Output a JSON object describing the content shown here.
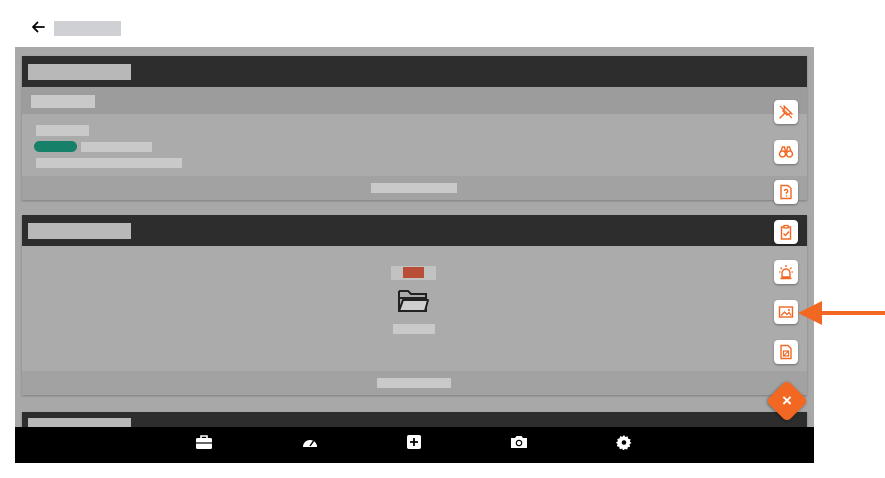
{
  "topbar": {
    "back_icon": "arrow-left-icon"
  },
  "colors": {
    "accent": "#f26822",
    "status_pill": "#168068",
    "header": "#2d2d2d",
    "overlay": "#a8a8a8"
  },
  "side_actions": [
    {
      "icon": "pin-icon"
    },
    {
      "icon": "binoculars-icon"
    },
    {
      "icon": "document-question-icon"
    },
    {
      "icon": "clipboard-check-icon"
    },
    {
      "icon": "alarm-light-icon"
    },
    {
      "icon": "image-icon"
    },
    {
      "icon": "document-drawing-icon"
    }
  ],
  "close_fab": {
    "label": "×"
  },
  "empty_state": {
    "icon": "folder-open-icon"
  },
  "bottom_nav": [
    {
      "icon": "briefcase-icon"
    },
    {
      "icon": "speedometer-icon"
    },
    {
      "icon": "plus-square-icon"
    },
    {
      "icon": "camera-icon"
    },
    {
      "icon": "gear-icon"
    }
  ]
}
